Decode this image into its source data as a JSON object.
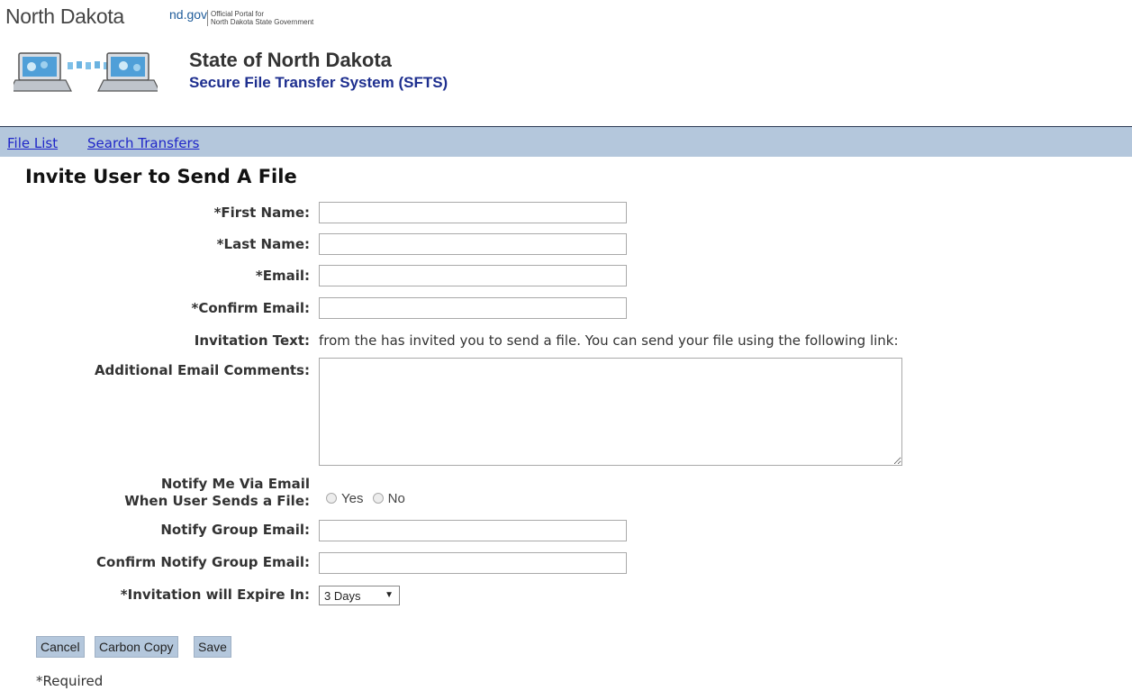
{
  "brand": {
    "state": "North Dakota",
    "ndgov": "nd.gov",
    "portal_line1": "Official Portal for",
    "portal_line2": "North Dakota State Government"
  },
  "header": {
    "title": "State of North Dakota",
    "subtitle": "Secure File Transfer System (SFTS)"
  },
  "nav": {
    "file_list": "File List",
    "search_transfers": "Search Transfers"
  },
  "form": {
    "heading": "Invite User to Send A File",
    "first_name_label": "*First Name:",
    "first_name_value": "",
    "last_name_label": "*Last Name:",
    "last_name_value": "",
    "email_label": "*Email:",
    "email_value": "",
    "confirm_email_label": "*Confirm Email:",
    "confirm_email_value": "",
    "invitation_text_label": "Invitation Text:",
    "invitation_text_value": "from the has invited you to send a file. You can send your file using the following link:",
    "additional_comments_label": "Additional Email Comments:",
    "additional_comments_value": "",
    "notify_label_line1": "Notify Me Via Email",
    "notify_label_line2": "When User Sends a File:",
    "notify_yes": "Yes",
    "notify_no": "No",
    "notify_group_label": "Notify Group Email:",
    "notify_group_value": "",
    "confirm_notify_group_label": "Confirm Notify Group Email:",
    "confirm_notify_group_value": "",
    "expire_label": "*Invitation will Expire In:",
    "expire_value": "3 Days"
  },
  "buttons": {
    "cancel": "Cancel",
    "carbon_copy": "Carbon Copy",
    "save": "Save"
  },
  "footer": {
    "required_note": "*Required"
  }
}
